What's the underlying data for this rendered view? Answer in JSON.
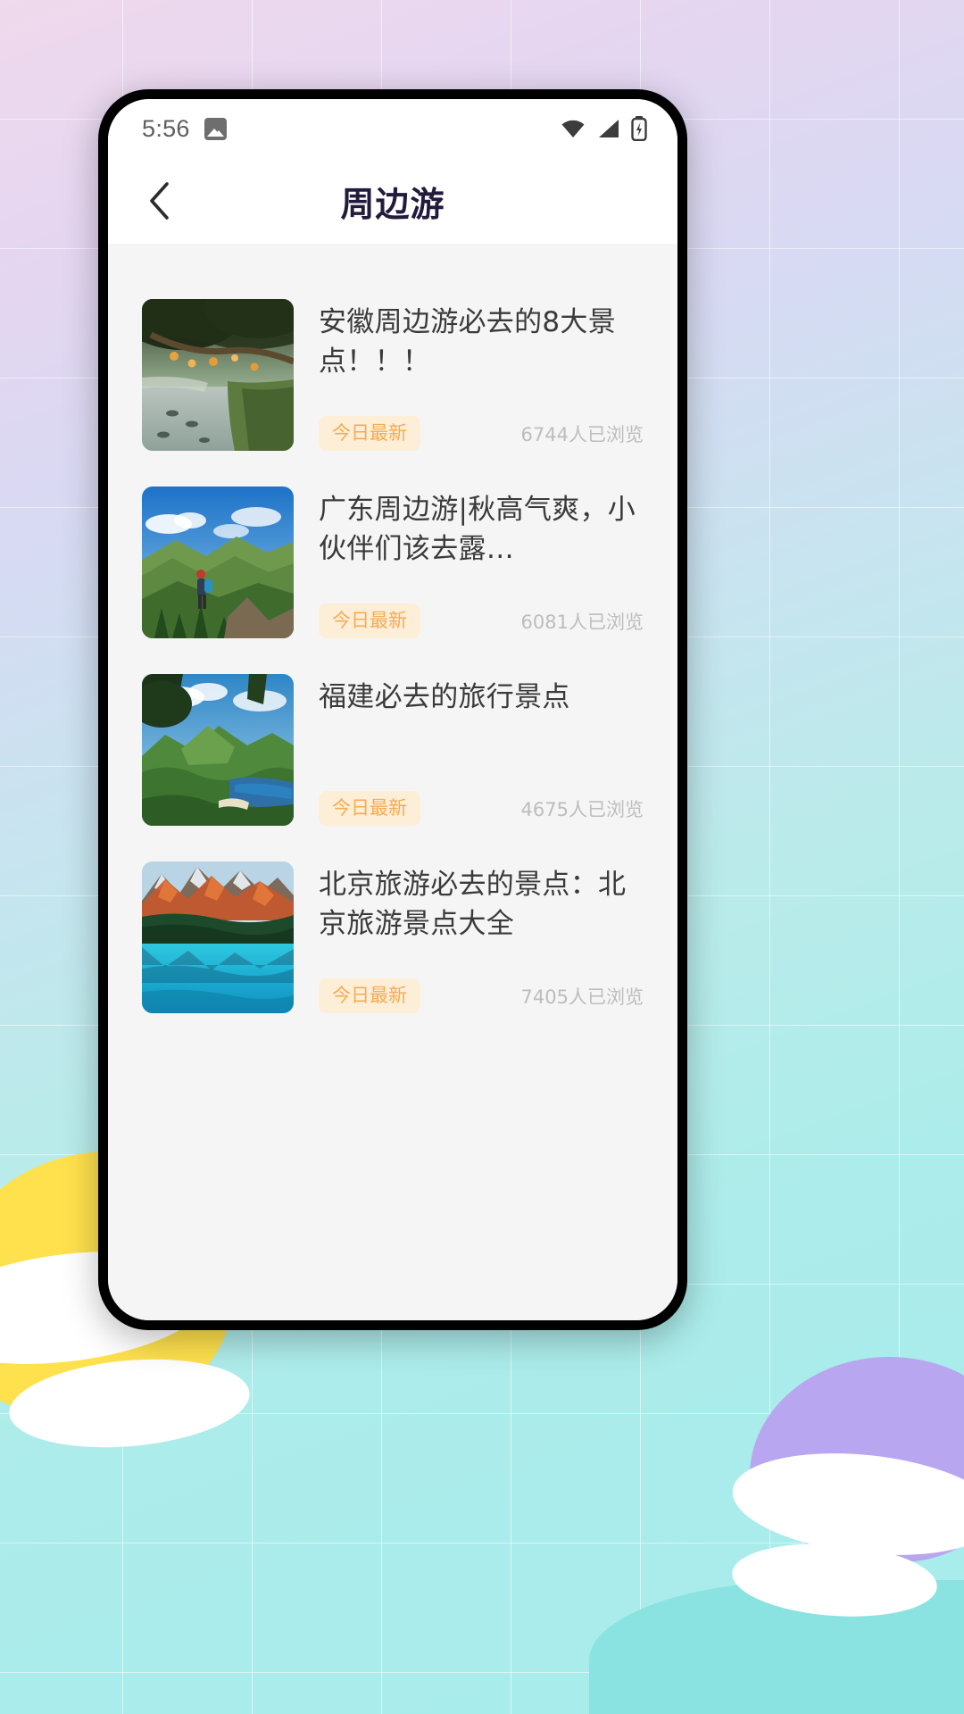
{
  "status_bar": {
    "time": "5:56",
    "photo_icon": "photo-icon",
    "wifi_icon": "wifi-icon",
    "signal_icon": "signal-icon",
    "battery_icon": "battery-icon"
  },
  "nav": {
    "back_icon": "chevron-left-icon",
    "title": "周边游"
  },
  "colors": {
    "badge_text": "#f5ac52",
    "badge_bg": "#fdeed8",
    "title_text": "#221b3c",
    "body_bg": "#f5f5f5",
    "views_text": "#bdbdbd"
  },
  "articles": [
    {
      "title": "安徽周边游必去的8大景点！！！",
      "badge": "今日最新",
      "views": "6744人已浏览",
      "thumb_name": "thumbnail-lantern-path"
    },
    {
      "title": "广东周边游|秋高气爽，小伙伴们该去露…",
      "badge": "今日最新",
      "views": "6081人已浏览",
      "thumb_name": "thumbnail-mountain-hiker"
    },
    {
      "title": "福建必去的旅行景点",
      "badge": "今日最新",
      "views": "4675人已浏览",
      "thumb_name": "thumbnail-green-coast"
    },
    {
      "title": "北京旅游必去的景点：北京旅游景点大全",
      "badge": "今日最新",
      "views": "7405人已浏览",
      "thumb_name": "thumbnail-lake-peaks"
    }
  ]
}
